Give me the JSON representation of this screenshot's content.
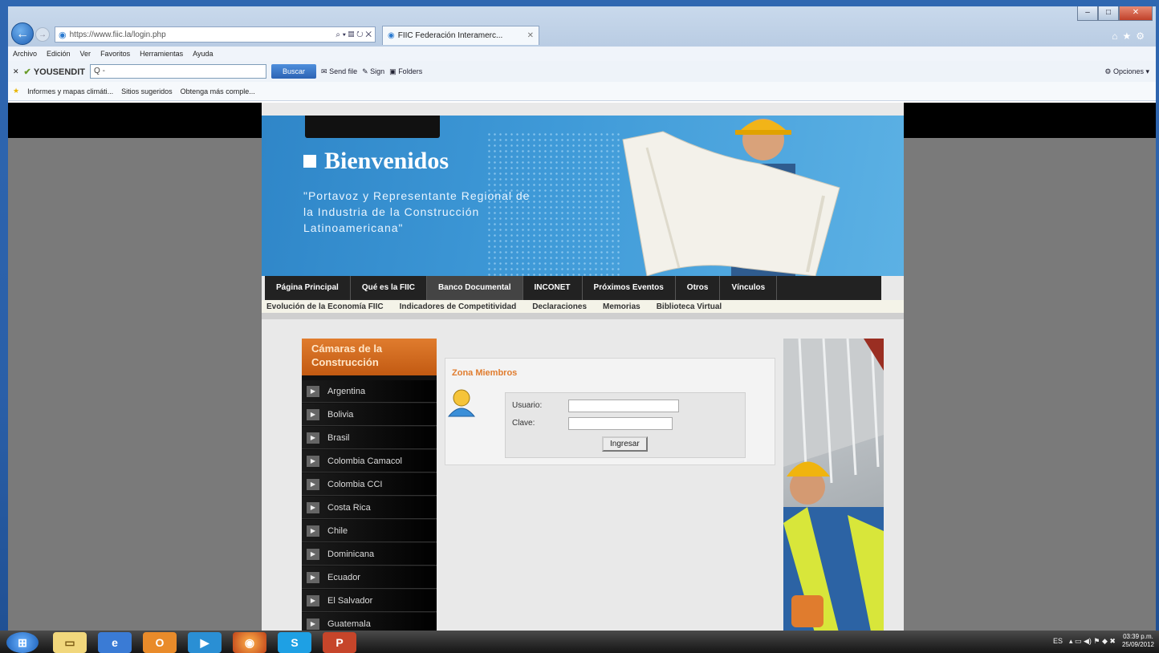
{
  "browser": {
    "url": "https://www.fiic.la/login.php",
    "tab_title": "FIIC Federación Interamerc...",
    "menu": [
      "Archivo",
      "Edición",
      "Ver",
      "Favoritos",
      "Herramientas",
      "Ayuda"
    ],
    "toolbar": {
      "brand": "YOUSENDIT",
      "search_placeholder": "Q -",
      "search_button": "Buscar",
      "send_file": "Send file",
      "sign": "Sign",
      "folders": "Folders",
      "options": "Opciones"
    },
    "favorites": [
      "Informes y mapas climáti...",
      "Sitios sugeridos",
      "Obtenga más comple..."
    ]
  },
  "site": {
    "welcome": "Bienvenidos",
    "tagline": "\"Portavoz y Representante Regional de la Industria de la Construcción Latinoamericana\"",
    "nav": [
      {
        "label": "Página Principal"
      },
      {
        "label": "Qué es la FIIC"
      },
      {
        "label": "Banco Documental"
      },
      {
        "label": "INCONET"
      },
      {
        "label": "Próximos Eventos"
      },
      {
        "label": "Otros"
      },
      {
        "label": "Vínculos"
      }
    ],
    "subnav": [
      "Evolución de la Economía FIIC",
      "Indicadores de Competitividad",
      "Declaraciones",
      "Memorias",
      "Biblioteca Virtual"
    ],
    "sidebar_title": "Cámaras de la Construcción",
    "countries": [
      "Argentina",
      "Bolivia",
      "Brasil",
      "Colombia Camacol",
      "Colombia CCI",
      "Costa Rica",
      "Chile",
      "Dominicana",
      "Ecuador",
      "El Salvador",
      "Guatemala"
    ],
    "login": {
      "title": "Zona Miembros",
      "user_label": "Usuario:",
      "pass_label": "Clave:",
      "submit": "Ingresar"
    }
  },
  "taskbar": {
    "lang": "ES",
    "time": "03:39 p.m.",
    "date": "25/09/2012"
  },
  "colors": {
    "accent_orange": "#e07c2e",
    "banner_blue": "#3f9ad8",
    "nav_dark": "#222222"
  }
}
